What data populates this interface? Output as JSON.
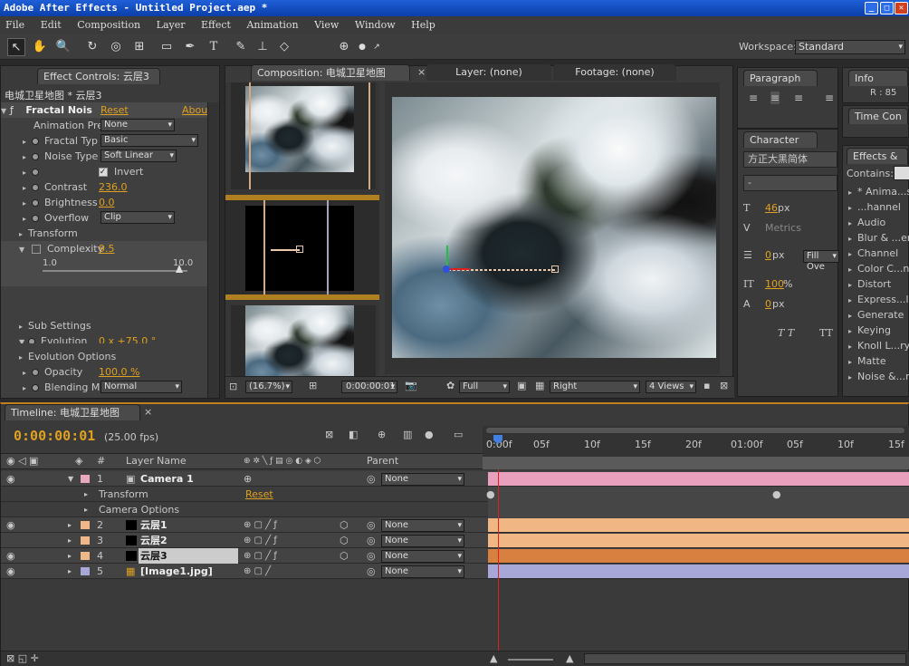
{
  "window": {
    "title": "Adobe After Effects - Untitled Project.aep *"
  },
  "menu": [
    "File",
    "Edit",
    "Composition",
    "Layer",
    "Effect",
    "Animation",
    "View",
    "Window",
    "Help"
  ],
  "workspace": {
    "label": "Workspace:",
    "value": "Standard"
  },
  "effect_controls": {
    "tab": "Effect Controls: 云层3",
    "breadcrumb": "电城卫星地图 * 云层3",
    "effect_name": "Fractal Nois",
    "reset": "Reset",
    "about": "Abou",
    "props": {
      "animation_preset_label": "Animation Pre",
      "animation_preset_value": "None",
      "fractal_type_label": "Fractal Typ",
      "fractal_type_value": "Basic",
      "noise_type_label": "Noise Type",
      "noise_type_value": "Soft Linear",
      "invert_label": "Invert",
      "contrast_label": "Contrast",
      "contrast_value": "236.0",
      "brightness_label": "Brightness",
      "brightness_value": "0.0",
      "overflow_label": "Overflow",
      "overflow_value": "Clip",
      "transform_label": "Transform",
      "complexity_label": "Complexity",
      "complexity_value": "9.5",
      "complexity_min": "1.0",
      "complexity_max": "10.0",
      "sub_settings_label": "Sub Settings",
      "evolution_label": "Evolution",
      "evolution_value": "0 x +75.0 °",
      "evolution_options_label": "Evolution Options",
      "opacity_label": "Opacity",
      "opacity_value": "100.0 %",
      "blending_label": "Blending M",
      "blending_value": "Normal"
    }
  },
  "composition": {
    "tab": "Composition: 电城卫星地图",
    "layer_tab": "Layer: (none)",
    "footage_tab": "Footage: (none)",
    "zoom": "(16.7%)",
    "time": "0:00:00:01",
    "resolution": "Full",
    "view": "Right",
    "views": "4 Views"
  },
  "paragraph": {
    "tab": "Paragraph"
  },
  "character": {
    "tab": "Character",
    "font": "方正大黑简体",
    "style": "-",
    "size": "46",
    "size_unit": "px",
    "metrics": "Metrics",
    "leading": "0",
    "leading_unit": "px",
    "fill": "Fill Ove",
    "scale": "100",
    "scale_unit": "%",
    "baseline": "0",
    "baseline_unit": "px"
  },
  "info": {
    "tab": "Info",
    "value": "R : 85"
  },
  "time_control": {
    "tab": "Time Con"
  },
  "effects_presets": {
    "tab": "Effects &",
    "contains_label": "Contains:",
    "items": [
      "* Anima...s",
      "...hannel",
      "Audio",
      "Blur & ...en",
      "Channel",
      "Color C...n",
      "Distort",
      "Express...ls",
      "Generate",
      "Keying",
      "Knoll L...ry",
      "Matte",
      "Noise &...n"
    ]
  },
  "timeline": {
    "tab": "Timeline: 电城卫星地图",
    "current_time": "0:00:00:01",
    "fps": "(25.00 fps)",
    "col_num": "#",
    "col_layer": "Layer Name",
    "col_parent": "Parent",
    "ruler": [
      "0:00f",
      "05f",
      "10f",
      "15f",
      "20f",
      "01:00f",
      "05f",
      "10f",
      "15f"
    ],
    "layers": [
      {
        "num": "1",
        "name": "Camera 1",
        "parent": "None",
        "color": "#e8a8c0",
        "bar": "#e8a0bc"
      },
      {
        "num": "2",
        "name": "云层1",
        "parent": "None",
        "color": "#f0b888",
        "bar": "#f0b684"
      },
      {
        "num": "3",
        "name": "云层2",
        "parent": "None",
        "color": "#f0b888",
        "bar": "#f0b684"
      },
      {
        "num": "4",
        "name": "云层3",
        "parent": "None",
        "color": "#f0b888",
        "bar": "#d88040"
      },
      {
        "num": "5",
        "name": "[Image1.jpg]",
        "parent": "None",
        "color": "#a8a8d8",
        "bar": "#a8a8d8"
      }
    ],
    "sub_transform": "Transform",
    "sub_reset": "Reset",
    "sub_camera_options": "Camera Options"
  }
}
